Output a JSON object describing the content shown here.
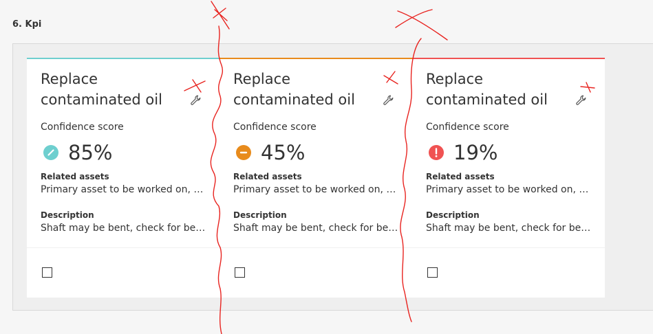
{
  "section": {
    "title": "6. Kpi"
  },
  "cards": [
    {
      "title": "Replace contaminated oil",
      "accent_color": "#6ecfcf",
      "confidence_label": "Confidence score",
      "confidence_value": "85%",
      "status_icon": "check-circle-icon",
      "status_color": "#6ecfcf",
      "related_assets_label": "Related assets",
      "related_assets_value": "Primary asset to be worked on, other assets",
      "description_label": "Description",
      "description_value": "Shaft may be bent, check for bending"
    },
    {
      "title": "Replace contaminated oil",
      "accent_color": "#e88b1c",
      "confidence_label": "Confidence score",
      "confidence_value": "45%",
      "status_icon": "minus-circle-icon",
      "status_color": "#e88b1c",
      "related_assets_label": "Related assets",
      "related_assets_value": "Primary asset to be worked on, other assets",
      "description_label": "Description",
      "description_value": "Shaft may be bent, check for bending"
    },
    {
      "title": "Replace contaminated oil",
      "accent_color": "#f05252",
      "confidence_label": "Confidence score",
      "confidence_value": "19%",
      "status_icon": "alert-circle-icon",
      "status_color": "#f05252",
      "related_assets_label": "Related assets",
      "related_assets_value": "Primary asset to be worked on, other assets",
      "description_label": "Description",
      "description_value": "Shaft may be bent, check for bending"
    }
  ]
}
